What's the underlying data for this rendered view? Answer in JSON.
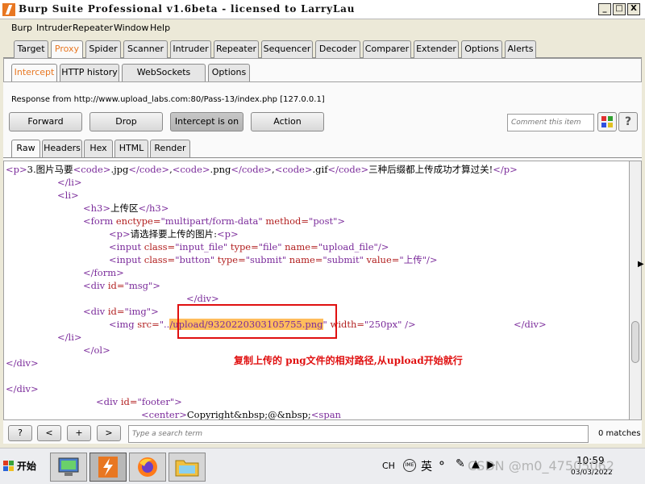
{
  "window": {
    "title": "Burp Suite Professional v1.6beta - licensed to LarryLau",
    "minimize": "_",
    "maximize": "□",
    "close": "X"
  },
  "menu": [
    "Burp",
    "Intruder",
    "Repeater",
    "Window",
    "Help"
  ],
  "main_tabs": [
    "Target",
    "Proxy",
    "Spider",
    "Scanner",
    "Intruder",
    "Repeater",
    "Sequencer",
    "Decoder",
    "Comparer",
    "Extender",
    "Options",
    "Alerts"
  ],
  "proxy_tabs": [
    "Intercept",
    "HTTP history",
    "WebSockets history",
    "Options"
  ],
  "intercept": {
    "response_from": "Response from http://www.upload_labs.com:80/Pass-13/index.php  [127.0.0.1]",
    "buttons": {
      "forward": "Forward",
      "drop": "Drop",
      "intercept": "Intercept is on",
      "action": "Action"
    },
    "comment_placeholder": "Comment this item",
    "help": "?"
  },
  "view_tabs": [
    "Raw",
    "Headers",
    "Hex",
    "HTML",
    "Render"
  ],
  "editor": {
    "l1": {
      "t1": "<p>",
      "x1": "3.图片马要",
      "t2": "<code>",
      "x2": ".jpg",
      "t3": "</code>",
      "x3": ",",
      "t4": "<code>",
      "x4": ".png",
      "t5": "</code>",
      "x5": ",",
      "t6": "<code>",
      "x6": ".gif",
      "t7": "</code>",
      "x7": "三种后缀都上传成功才算过关!",
      "t8": "</p>"
    },
    "l2": "</li>",
    "l3": "<li>",
    "l4": {
      "t1": "<h3>",
      "x1": "上传区",
      "t2": "</h3>"
    },
    "l5": {
      "t1": "<form",
      "a1": " enctype=",
      "v1": "\"multipart/form-data\"",
      "a2": " method=",
      "v2": "\"post\"",
      "t2": ">"
    },
    "l6": {
      "t1": "<p>",
      "x1": "请选择要上传的图片:",
      "t2": "<p>"
    },
    "l7": {
      "t1": "<input",
      "a1": " class=",
      "v1": "\"input_file\"",
      "a2": " type=",
      "v2": "\"file\"",
      "a3": " name=",
      "v3": "\"upload_file\"",
      "t2": "/>"
    },
    "l8": {
      "t1": "<input",
      "a1": " class=",
      "v1": "\"button\"",
      "a2": " type=",
      "v2": "\"submit\"",
      "a3": " name=",
      "v3": "\"submit\"",
      "a4": " value=",
      "v4": "\"上传\"",
      "t2": "/>"
    },
    "l9": "</form>",
    "l10": {
      "t1": "<div",
      "a1": " id=",
      "v1": "\"msg\"",
      "t2": ">"
    },
    "l11": "</div>",
    "l12": {
      "t1": "<div",
      "a1": " id=",
      "v1": "\"img\"",
      "t2": ">"
    },
    "l13": {
      "t1": "<img",
      "a1": " src=",
      "v1a": "\"..",
      "v1b": "/upload/9320220303105755.png",
      "v1c": "\"",
      "a2": " width=",
      "v2": "\"250px\"",
      "t2": " />",
      "t3": "</div>"
    },
    "l14": "</li>",
    "l15": "</ol>",
    "l16": "</div>",
    "l17": "</div>",
    "l18": {
      "t1": "<div",
      "a1": " id=",
      "v1": "\"footer\"",
      "t2": ">"
    },
    "l19": {
      "t1": "<center>",
      "x1": "Copyright&nbsp;@&nbsp;",
      "t2": "<span"
    }
  },
  "annotation": "复制上传的 png文件的相对路径,从upload开始就行",
  "search": {
    "help": "?",
    "prev": "<",
    "add": "+",
    "next": ">",
    "placeholder": "Type a search term",
    "matches": "0 matches"
  },
  "taskbar": {
    "start": "开始",
    "lang": "CH",
    "time": "10:59",
    "date": "03/03/2022",
    "watermark": "CSDN @m0_47505062"
  },
  "colors": {
    "accent": "#e87722",
    "annotation": "#e01010",
    "highlight": "#ffbd5c",
    "tag": "#7a2a9a",
    "attr": "#b22020"
  }
}
